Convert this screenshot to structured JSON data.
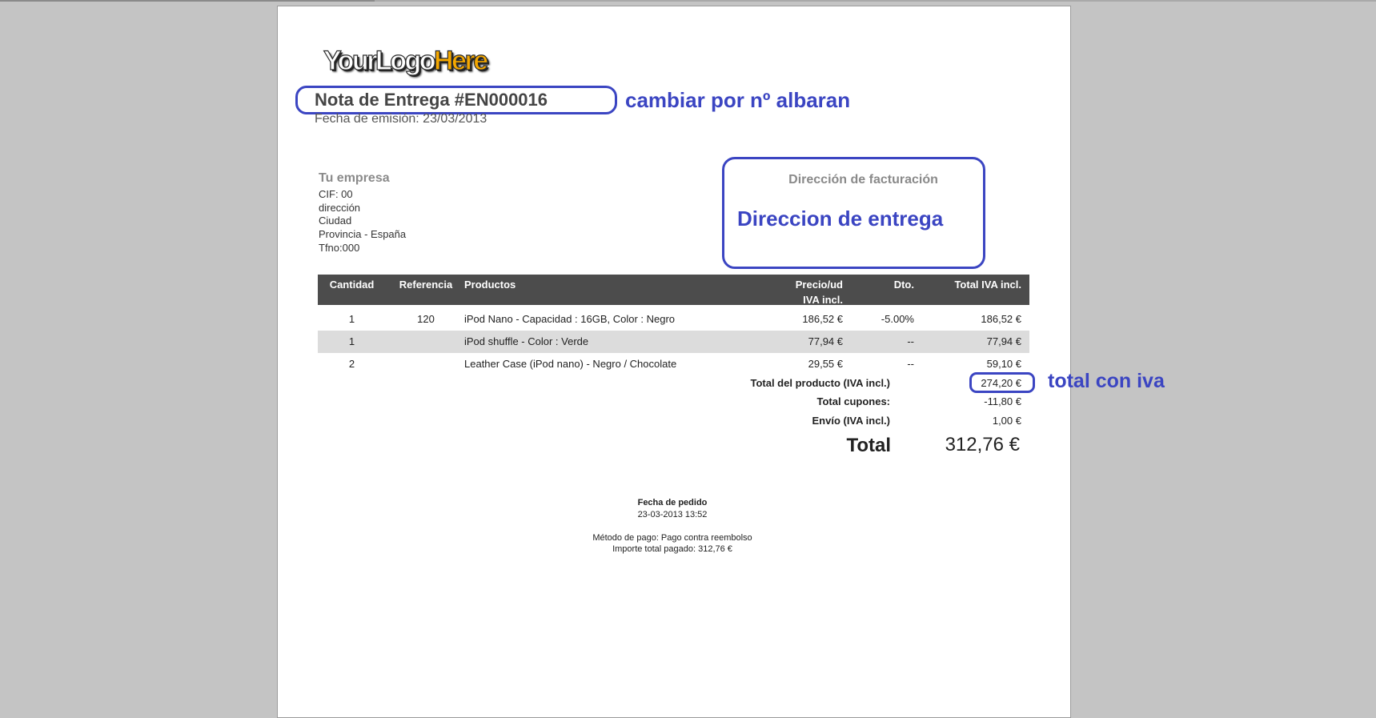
{
  "logo": {
    "part1": "YourLogo",
    "part2": "Here"
  },
  "document": {
    "title": "Nota de Entrega #EN000016",
    "emission_date": "Fecha de emisión: 23/03/2013"
  },
  "company": {
    "name": "Tu empresa",
    "lines": [
      "CIF: 00",
      "dirección",
      "Ciudad",
      "Provincia - España",
      "Tfno:000"
    ]
  },
  "billing": {
    "title": "Dirección de facturación"
  },
  "annotations": {
    "title_note": "cambiar por nº albaran",
    "address_note": "Direccion de entrega",
    "total_note": "total con iva",
    "color": "#3b45c2"
  },
  "table": {
    "headers": {
      "qty": "Cantidad",
      "ref": "Referencia",
      "product": "Productos",
      "price_line1": "Precio/ud",
      "price_line2": "IVA incl.",
      "discount": "Dto.",
      "total": "Total IVA incl."
    },
    "rows": [
      {
        "qty": "1",
        "ref": "120",
        "product": "iPod Nano - Capacidad : 16GB, Color : Negro",
        "price": "186,52 €",
        "discount": "-5.00%",
        "total": "186,52 €"
      },
      {
        "qty": "1",
        "ref": "",
        "product": "iPod shuffle - Color : Verde",
        "price": "77,94 €",
        "discount": "--",
        "total": "77,94 €"
      },
      {
        "qty": "2",
        "ref": "",
        "product": "Leather Case (iPod nano) - Negro / Chocolate",
        "price": "29,55 €",
        "discount": "--",
        "total": "59,10 €"
      }
    ]
  },
  "summary": {
    "product_total_label": "Total del producto (IVA incl.)",
    "product_total_value": "274,20 €",
    "coupons_label": "Total cupones:",
    "coupons_value": "-11,80 €",
    "shipping_label": "Envío (IVA incl.)",
    "shipping_value": "1,00 €",
    "grand_total_label": "Total",
    "grand_total_value": "312,76 €"
  },
  "footer": {
    "order_date_label": "Fecha de pedido",
    "order_date_value": "23-03-2013 13:52",
    "payment_method": "Método de pago: Pago contra reembolso",
    "amount_paid": "Importe total pagado: 312,76 €"
  }
}
